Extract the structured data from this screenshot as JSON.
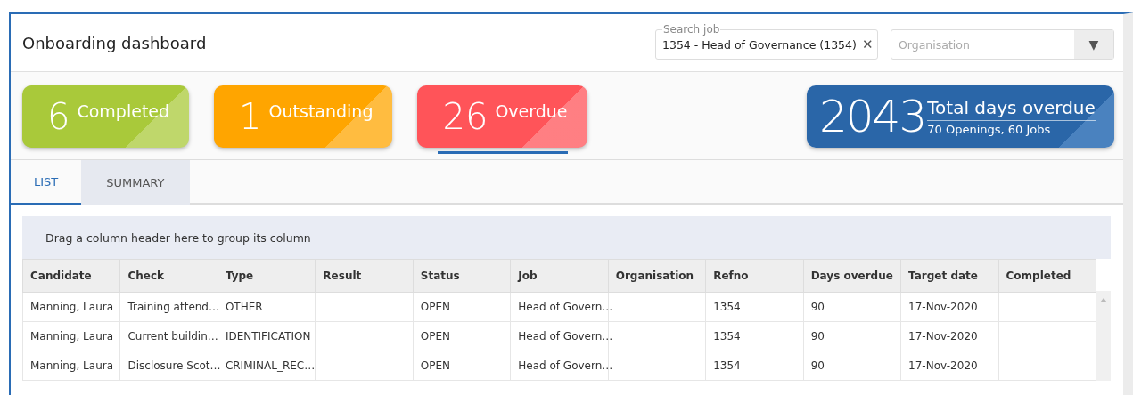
{
  "header": {
    "title": "Onboarding dashboard",
    "search": {
      "label": "Search job",
      "value": "1354 - Head of Governance (1354)",
      "clear": "✕"
    },
    "organisation": {
      "placeholder": "Organisation",
      "arrow": "▼"
    }
  },
  "cards": [
    {
      "count": "6",
      "label": "Completed",
      "color": "#a9c93a",
      "selected": false
    },
    {
      "count": "1",
      "label": "Outstanding",
      "color": "#ffa500",
      "selected": false
    },
    {
      "count": "26",
      "label": "Overdue",
      "color": "#ff5459",
      "selected": true
    }
  ],
  "total": {
    "count": "2043",
    "label": "Total days overdue",
    "sub": "70 Openings, 60 Jobs"
  },
  "tabs": [
    {
      "label": "LIST",
      "selected": true
    },
    {
      "label": "SUMMARY",
      "selected": false
    }
  ],
  "grid": {
    "group_hint": "Drag a column header here to group its column",
    "columns": [
      "Candidate",
      "Check",
      "Type",
      "Result",
      "Status",
      "Job",
      "Organisation",
      "Refno",
      "Days overdue",
      "Target date",
      "Completed"
    ],
    "rows": [
      [
        "Manning, Laura",
        "Training attend…",
        "OTHER",
        "",
        "OPEN",
        "Head of Govern…",
        "",
        "1354",
        "90",
        "17-Nov-2020",
        ""
      ],
      [
        "Manning, Laura",
        "Current buildin…",
        "IDENTIFICATION",
        "",
        "OPEN",
        "Head of Govern…",
        "",
        "1354",
        "90",
        "17-Nov-2020",
        ""
      ],
      [
        "Manning, Laura",
        "Disclosure Scot…",
        "CRIMINAL_REC…",
        "",
        "OPEN",
        "Head of Govern…",
        "",
        "1354",
        "90",
        "17-Nov-2020",
        ""
      ]
    ]
  }
}
